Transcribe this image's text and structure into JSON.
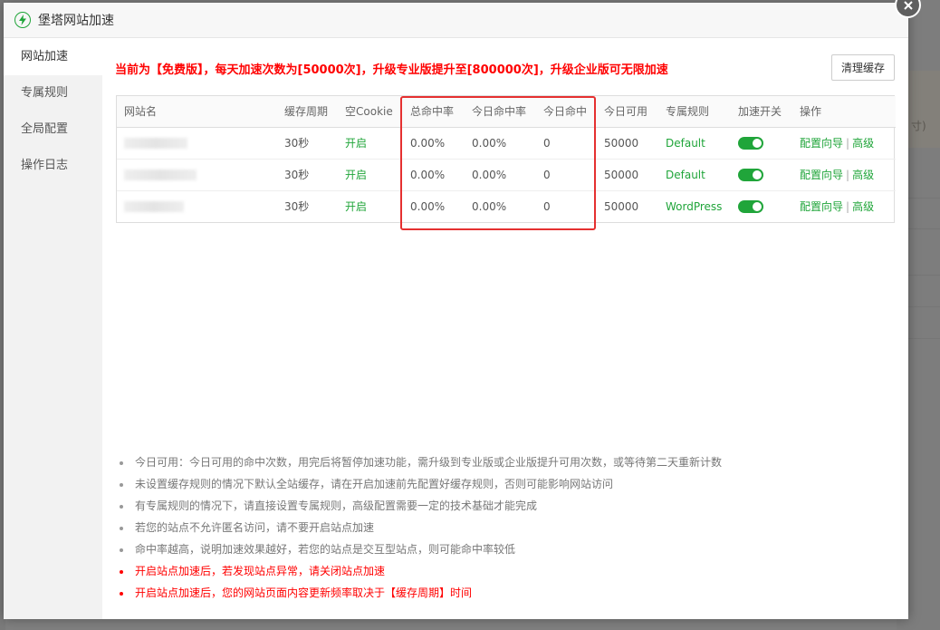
{
  "window": {
    "title": "堡塔网站加速"
  },
  "sidebar": {
    "items": [
      {
        "label": "网站加速"
      },
      {
        "label": "专属规则"
      },
      {
        "label": "全局配置"
      },
      {
        "label": "操作日志"
      }
    ]
  },
  "notice": "当前为【免费版】，每天加速次数为[50000次]，升级专业版提升至[800000次]，升级企业版可无限加速",
  "toolbar": {
    "clear_cache_label": "清理缓存"
  },
  "table": {
    "headers": [
      "网站名",
      "缓存周期",
      "空Cookie",
      "总命中率",
      "今日命中率",
      "今日命中",
      "今日可用",
      "专属规则",
      "加速开关",
      "操作"
    ],
    "rows": [
      {
        "cache_period": "30秒",
        "cookie": "开启",
        "total_hit_rate": "0.00%",
        "today_hit_rate": "0.00%",
        "today_hits": "0",
        "today_available": "50000",
        "rule": "Default",
        "switch_on": true,
        "action_config": "配置向导",
        "action_sep": "|",
        "action_advanced": "高级"
      },
      {
        "cache_period": "30秒",
        "cookie": "开启",
        "total_hit_rate": "0.00%",
        "today_hit_rate": "0.00%",
        "today_hits": "0",
        "today_available": "50000",
        "rule": "Default",
        "switch_on": true,
        "action_config": "配置向导",
        "action_sep": "|",
        "action_advanced": "高级"
      },
      {
        "cache_period": "30秒",
        "cookie": "开启",
        "total_hit_rate": "0.00%",
        "today_hit_rate": "0.00%",
        "today_hits": "0",
        "today_available": "50000",
        "rule": "WordPress",
        "switch_on": true,
        "action_config": "配置向导",
        "action_sep": "|",
        "action_advanced": "高级"
      }
    ]
  },
  "tips": [
    {
      "text": "今日可用：今日可用的命中次数，用完后将暂停加速功能，需升级到专业版或企业版提升可用次数，或等待第二天重新计数",
      "warn": false
    },
    {
      "text": "未设置缓存规则的情况下默认全站缓存，请在开启加速前先配置好缓存规则，否则可能影响网站访问",
      "warn": false
    },
    {
      "text": "有专属规则的情况下，请直接设置专属规则，高级配置需要一定的技术基础才能完成",
      "warn": false
    },
    {
      "text": "若您的站点不允许匿名访问，请不要开启站点加速",
      "warn": false
    },
    {
      "text": "命中率越高，说明加速效果越好，若您的站点是交互型站点，则可能命中率较低",
      "warn": false
    },
    {
      "text": "开启站点加速后，若发现站点异常，请关闭站点加速",
      "warn": true
    },
    {
      "text": "开启站点加速后，您的网站页面内容更新频率取决于【缓存周期】时间",
      "warn": true
    }
  ],
  "background": {
    "text": "寸)"
  },
  "colors": {
    "accent": "#20a53a",
    "warning": "#ff0000",
    "highlight_box": "#e53030"
  }
}
